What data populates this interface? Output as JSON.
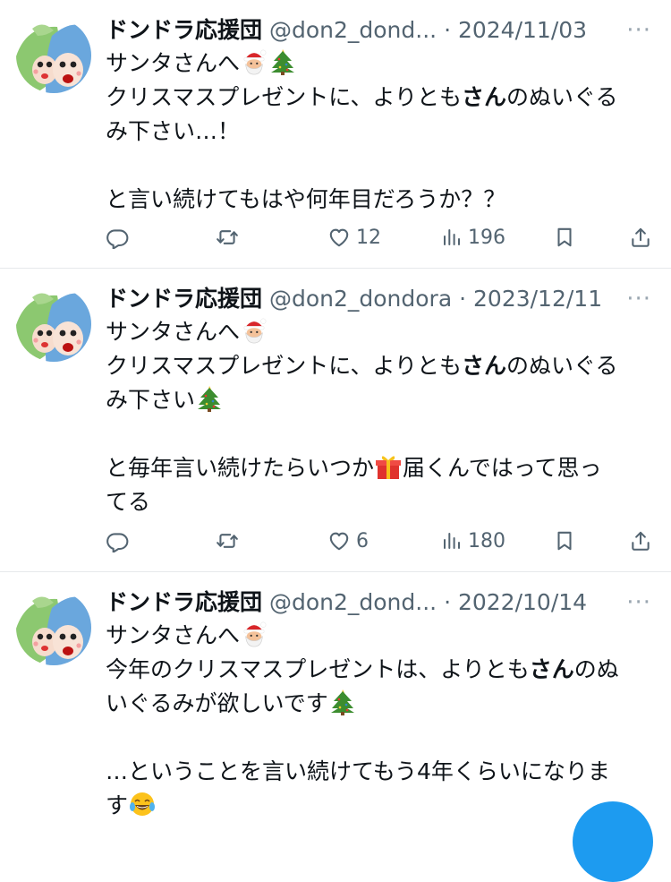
{
  "tweets": [
    {
      "name": "ドンドラ応援団",
      "handle": "@don2_dond...",
      "separator": "·",
      "date": "2024/11/03",
      "line1": "サンタさんへ",
      "line2a": "クリスマスプレゼントに、よりとも",
      "bold": "さん",
      "line2b": "のぬいぐる",
      "line3": "み下さい…！",
      "line4": "と言い続けてもはや何年目だろうか？？",
      "replies": "",
      "retweets": "",
      "likes": "12",
      "views": "196"
    },
    {
      "name": "ドンドラ応援団",
      "handle": "@don2_dondora",
      "separator": "·",
      "date": "2023/12/11",
      "line1": "サンタさんへ",
      "line2a": "クリスマスプレゼントに、よりとも",
      "bold": "さん",
      "line2b": "のぬいぐる",
      "line3": "み下さい",
      "line4a": "と毎年言い続けたらいつか",
      "line4b": "届くんではって思っ",
      "line5": "てる",
      "replies": "",
      "retweets": "",
      "likes": "6",
      "views": "180"
    },
    {
      "name": "ドンドラ応援団",
      "handle": "@don2_dond...",
      "separator": "·",
      "date": "2022/10/14",
      "line1": "サンタさんへ",
      "line2a": "今年のクリスマスプレゼントは、よりとも",
      "bold": "さん",
      "line2b": "のぬ",
      "line3": "いぐるみが欲しいです",
      "line4": "…ということを言い続けてもう4年くらいになりま",
      "line5": "す"
    }
  ],
  "more_label": "···",
  "icons": {
    "reply": "reply-icon",
    "retweet": "retweet-icon",
    "like": "heart-icon",
    "views": "views-chart-icon",
    "bookmark": "bookmark-icon",
    "share": "share-icon",
    "emoji_santa": "santa-emoji",
    "emoji_tree": "christmas-tree-emoji",
    "emoji_gift": "gift-emoji",
    "emoji_laugh": "tears-of-joy-emoji"
  },
  "colors": {
    "text": "#0f1419",
    "secondary": "#536471",
    "divider": "#e6e9eb",
    "accent": "#1d9bf0"
  }
}
